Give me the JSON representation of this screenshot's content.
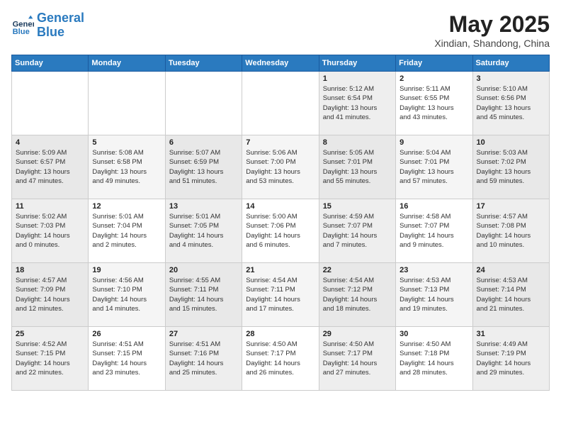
{
  "header": {
    "logo_line1": "General",
    "logo_line2": "Blue",
    "month": "May 2025",
    "location": "Xindian, Shandong, China"
  },
  "weekdays": [
    "Sunday",
    "Monday",
    "Tuesday",
    "Wednesday",
    "Thursday",
    "Friday",
    "Saturday"
  ],
  "weeks": [
    [
      {
        "day": "",
        "info": ""
      },
      {
        "day": "",
        "info": ""
      },
      {
        "day": "",
        "info": ""
      },
      {
        "day": "",
        "info": ""
      },
      {
        "day": "1",
        "info": "Sunrise: 5:12 AM\nSunset: 6:54 PM\nDaylight: 13 hours\nand 41 minutes."
      },
      {
        "day": "2",
        "info": "Sunrise: 5:11 AM\nSunset: 6:55 PM\nDaylight: 13 hours\nand 43 minutes."
      },
      {
        "day": "3",
        "info": "Sunrise: 5:10 AM\nSunset: 6:56 PM\nDaylight: 13 hours\nand 45 minutes."
      }
    ],
    [
      {
        "day": "4",
        "info": "Sunrise: 5:09 AM\nSunset: 6:57 PM\nDaylight: 13 hours\nand 47 minutes."
      },
      {
        "day": "5",
        "info": "Sunrise: 5:08 AM\nSunset: 6:58 PM\nDaylight: 13 hours\nand 49 minutes."
      },
      {
        "day": "6",
        "info": "Sunrise: 5:07 AM\nSunset: 6:59 PM\nDaylight: 13 hours\nand 51 minutes."
      },
      {
        "day": "7",
        "info": "Sunrise: 5:06 AM\nSunset: 7:00 PM\nDaylight: 13 hours\nand 53 minutes."
      },
      {
        "day": "8",
        "info": "Sunrise: 5:05 AM\nSunset: 7:01 PM\nDaylight: 13 hours\nand 55 minutes."
      },
      {
        "day": "9",
        "info": "Sunrise: 5:04 AM\nSunset: 7:01 PM\nDaylight: 13 hours\nand 57 minutes."
      },
      {
        "day": "10",
        "info": "Sunrise: 5:03 AM\nSunset: 7:02 PM\nDaylight: 13 hours\nand 59 minutes."
      }
    ],
    [
      {
        "day": "11",
        "info": "Sunrise: 5:02 AM\nSunset: 7:03 PM\nDaylight: 14 hours\nand 0 minutes."
      },
      {
        "day": "12",
        "info": "Sunrise: 5:01 AM\nSunset: 7:04 PM\nDaylight: 14 hours\nand 2 minutes."
      },
      {
        "day": "13",
        "info": "Sunrise: 5:01 AM\nSunset: 7:05 PM\nDaylight: 14 hours\nand 4 minutes."
      },
      {
        "day": "14",
        "info": "Sunrise: 5:00 AM\nSunset: 7:06 PM\nDaylight: 14 hours\nand 6 minutes."
      },
      {
        "day": "15",
        "info": "Sunrise: 4:59 AM\nSunset: 7:07 PM\nDaylight: 14 hours\nand 7 minutes."
      },
      {
        "day": "16",
        "info": "Sunrise: 4:58 AM\nSunset: 7:07 PM\nDaylight: 14 hours\nand 9 minutes."
      },
      {
        "day": "17",
        "info": "Sunrise: 4:57 AM\nSunset: 7:08 PM\nDaylight: 14 hours\nand 10 minutes."
      }
    ],
    [
      {
        "day": "18",
        "info": "Sunrise: 4:57 AM\nSunset: 7:09 PM\nDaylight: 14 hours\nand 12 minutes."
      },
      {
        "day": "19",
        "info": "Sunrise: 4:56 AM\nSunset: 7:10 PM\nDaylight: 14 hours\nand 14 minutes."
      },
      {
        "day": "20",
        "info": "Sunrise: 4:55 AM\nSunset: 7:11 PM\nDaylight: 14 hours\nand 15 minutes."
      },
      {
        "day": "21",
        "info": "Sunrise: 4:54 AM\nSunset: 7:11 PM\nDaylight: 14 hours\nand 17 minutes."
      },
      {
        "day": "22",
        "info": "Sunrise: 4:54 AM\nSunset: 7:12 PM\nDaylight: 14 hours\nand 18 minutes."
      },
      {
        "day": "23",
        "info": "Sunrise: 4:53 AM\nSunset: 7:13 PM\nDaylight: 14 hours\nand 19 minutes."
      },
      {
        "day": "24",
        "info": "Sunrise: 4:53 AM\nSunset: 7:14 PM\nDaylight: 14 hours\nand 21 minutes."
      }
    ],
    [
      {
        "day": "25",
        "info": "Sunrise: 4:52 AM\nSunset: 7:15 PM\nDaylight: 14 hours\nand 22 minutes."
      },
      {
        "day": "26",
        "info": "Sunrise: 4:51 AM\nSunset: 7:15 PM\nDaylight: 14 hours\nand 23 minutes."
      },
      {
        "day": "27",
        "info": "Sunrise: 4:51 AM\nSunset: 7:16 PM\nDaylight: 14 hours\nand 25 minutes."
      },
      {
        "day": "28",
        "info": "Sunrise: 4:50 AM\nSunset: 7:17 PM\nDaylight: 14 hours\nand 26 minutes."
      },
      {
        "day": "29",
        "info": "Sunrise: 4:50 AM\nSunset: 7:17 PM\nDaylight: 14 hours\nand 27 minutes."
      },
      {
        "day": "30",
        "info": "Sunrise: 4:50 AM\nSunset: 7:18 PM\nDaylight: 14 hours\nand 28 minutes."
      },
      {
        "day": "31",
        "info": "Sunrise: 4:49 AM\nSunset: 7:19 PM\nDaylight: 14 hours\nand 29 minutes."
      }
    ]
  ]
}
